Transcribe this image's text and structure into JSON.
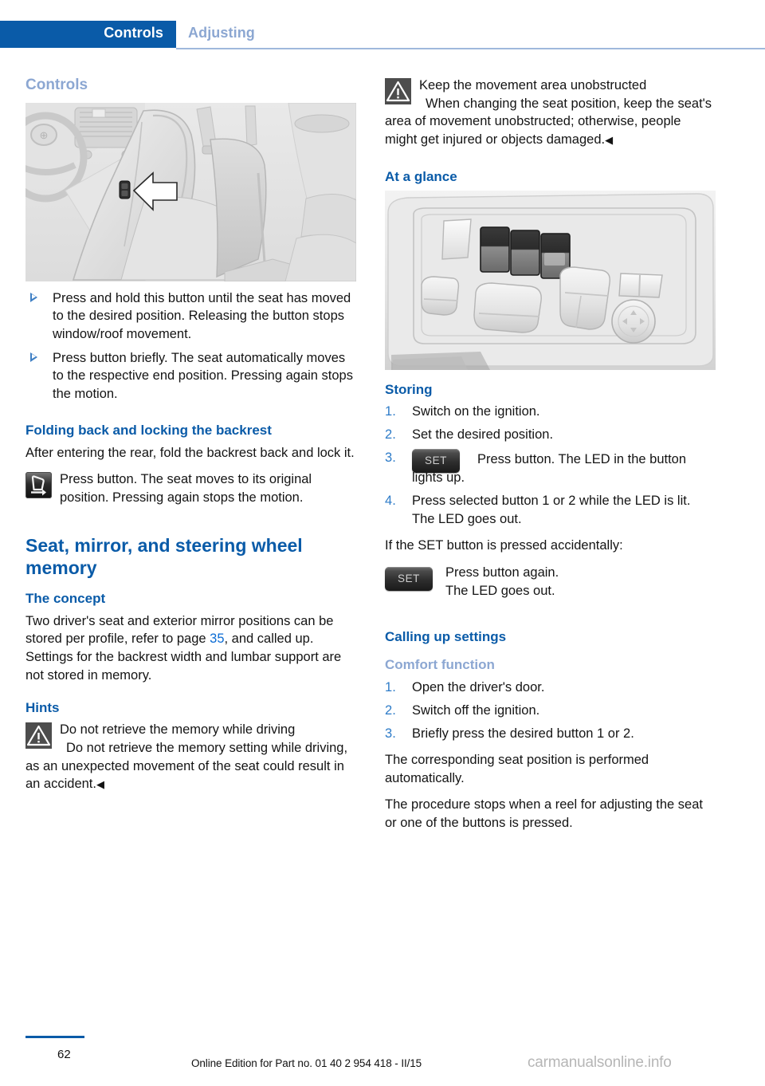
{
  "header": {
    "active_tab": "Controls",
    "inactive_tab": "Adjusting",
    "accent_color": "#0A5BA8",
    "muted_color": "#8CA7D2"
  },
  "left_column": {
    "page_heading": "Controls",
    "figure_caption": "car-interior-seat-button-illustration",
    "bullets": [
      "Press and hold this button until the seat has moved to the desired position. Releasing the button stops window/roof movement.",
      "Press button briefly. The seat automatically moves to the respective end position. Pressing again stops the motion."
    ],
    "folding_heading": "Folding back and locking the backrest",
    "folding_intro": "After entering the rear, fold the backrest back and lock it.",
    "folding_note": "Press button. The seat moves to its original position. Pressing again stops the motion.",
    "memory_title": "Seat, mirror, and steering wheel memory",
    "concept_heading": "The concept",
    "concept_text_before": "Two driver's seat and exterior mirror positions can be stored per profile, refer to page ",
    "concept_page_ref": "35",
    "concept_text_after": ", and called up. Settings for the backrest width and lumbar support are not stored in memory.",
    "hints_heading": "Hints",
    "hints_warning_title": "Do not retrieve the memory while driving",
    "hints_warning_body": "Do not retrieve the memory setting while driving, as an unexpected movement of the seat could result in an accident.",
    "hints_endmark": "◀"
  },
  "right_column": {
    "warning_title": "Keep the movement area unobstructed",
    "warning_body": "When changing the seat position, keep the seat's area of movement unobstructed; otherwise, people might get injured or objects damaged.",
    "warning_endmark": "◀",
    "at_a_glance_heading": "At a glance",
    "figure_caption": "seat-memory-control-panel-illustration",
    "storing_heading": "Storing",
    "storing_steps": [
      "Switch on the ignition.",
      "Set the desired position.",
      "Press button. The LED in the button lights up.",
      "Press selected button 1 or 2 while the LED is lit. The LED goes out."
    ],
    "storing_step3_button_label": "SET",
    "accidental_text": "If the SET button is pressed accidentally:",
    "accidental_button_label": "SET",
    "accidental_line1": "Press button again.",
    "accidental_line2": "The LED goes out.",
    "calling_heading": "Calling up settings",
    "comfort_heading": "Comfort function",
    "comfort_steps": [
      "Open the driver's door.",
      "Switch off the ignition.",
      "Briefly press the desired button 1 or 2."
    ],
    "comfort_note1": "The corresponding seat position is performed automatically.",
    "comfort_note2": "The procedure stops when a reel for adjusting the seat or one of the buttons is pressed."
  },
  "footer": {
    "page_number": "62",
    "edition": "Online Edition for Part no. 01 40 2 954 418 - II/15",
    "watermark": "carmanualsonline.info"
  }
}
